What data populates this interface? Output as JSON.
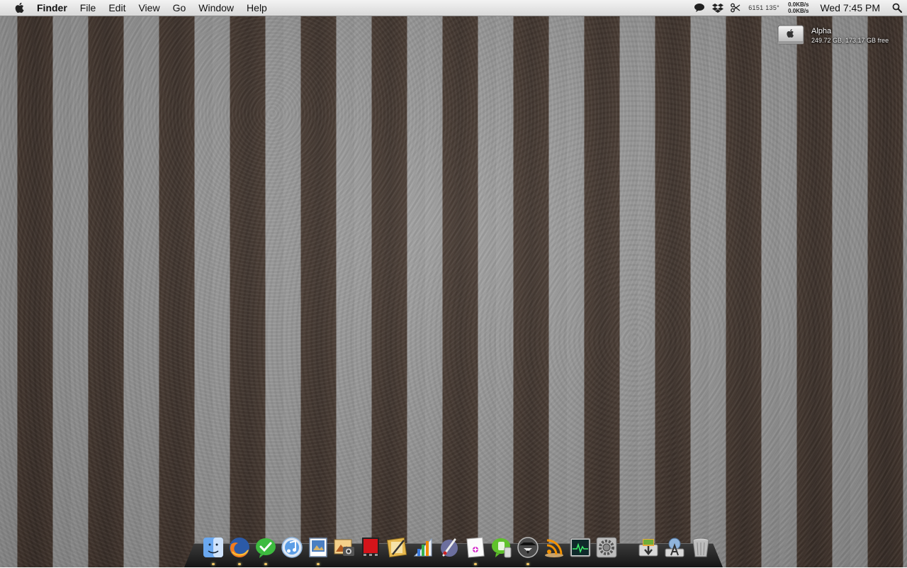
{
  "menubar": {
    "app_name": "Finder",
    "menus": [
      "File",
      "Edit",
      "View",
      "Go",
      "Window",
      "Help"
    ],
    "status_text": "6151 135°",
    "net_up": "0.0KB/s",
    "net_down": "0.0KB/s",
    "clock": "Wed 7:45 PM",
    "status_icons": [
      "chat-bubble-icon",
      "dropbox-icon",
      "scissors-icon"
    ]
  },
  "drive": {
    "name": "Alpha",
    "info": "249.72 GB, 173.17 GB free"
  },
  "dock": {
    "apps": [
      {
        "name": "finder-icon",
        "running": true
      },
      {
        "name": "firefox-icon",
        "running": true
      },
      {
        "name": "checkmark-chat-icon",
        "running": true
      },
      {
        "name": "itunes-icon",
        "running": false
      },
      {
        "name": "preview-icon",
        "running": true
      },
      {
        "name": "iphoto-icon",
        "running": false
      },
      {
        "name": "photobooth-icon",
        "running": false
      },
      {
        "name": "pixelmator-icon",
        "running": false
      },
      {
        "name": "activity-chart-icon",
        "running": false
      },
      {
        "name": "brushes-icon",
        "running": false
      },
      {
        "name": "notes-icon",
        "running": true
      },
      {
        "name": "evernote-icon",
        "running": false
      },
      {
        "name": "alfred-icon",
        "running": true
      },
      {
        "name": "rss-icon",
        "running": false
      },
      {
        "name": "activity-monitor-icon",
        "running": false
      },
      {
        "name": "system-preferences-icon",
        "running": false
      }
    ],
    "stacks": [
      {
        "name": "downloads-icon"
      },
      {
        "name": "applications-icon"
      },
      {
        "name": "trash-icon"
      }
    ]
  },
  "colors": {
    "stripe_light": "#a1a1a1",
    "stripe_dark": "#3f332c",
    "menubar": "#e6e6e6"
  }
}
